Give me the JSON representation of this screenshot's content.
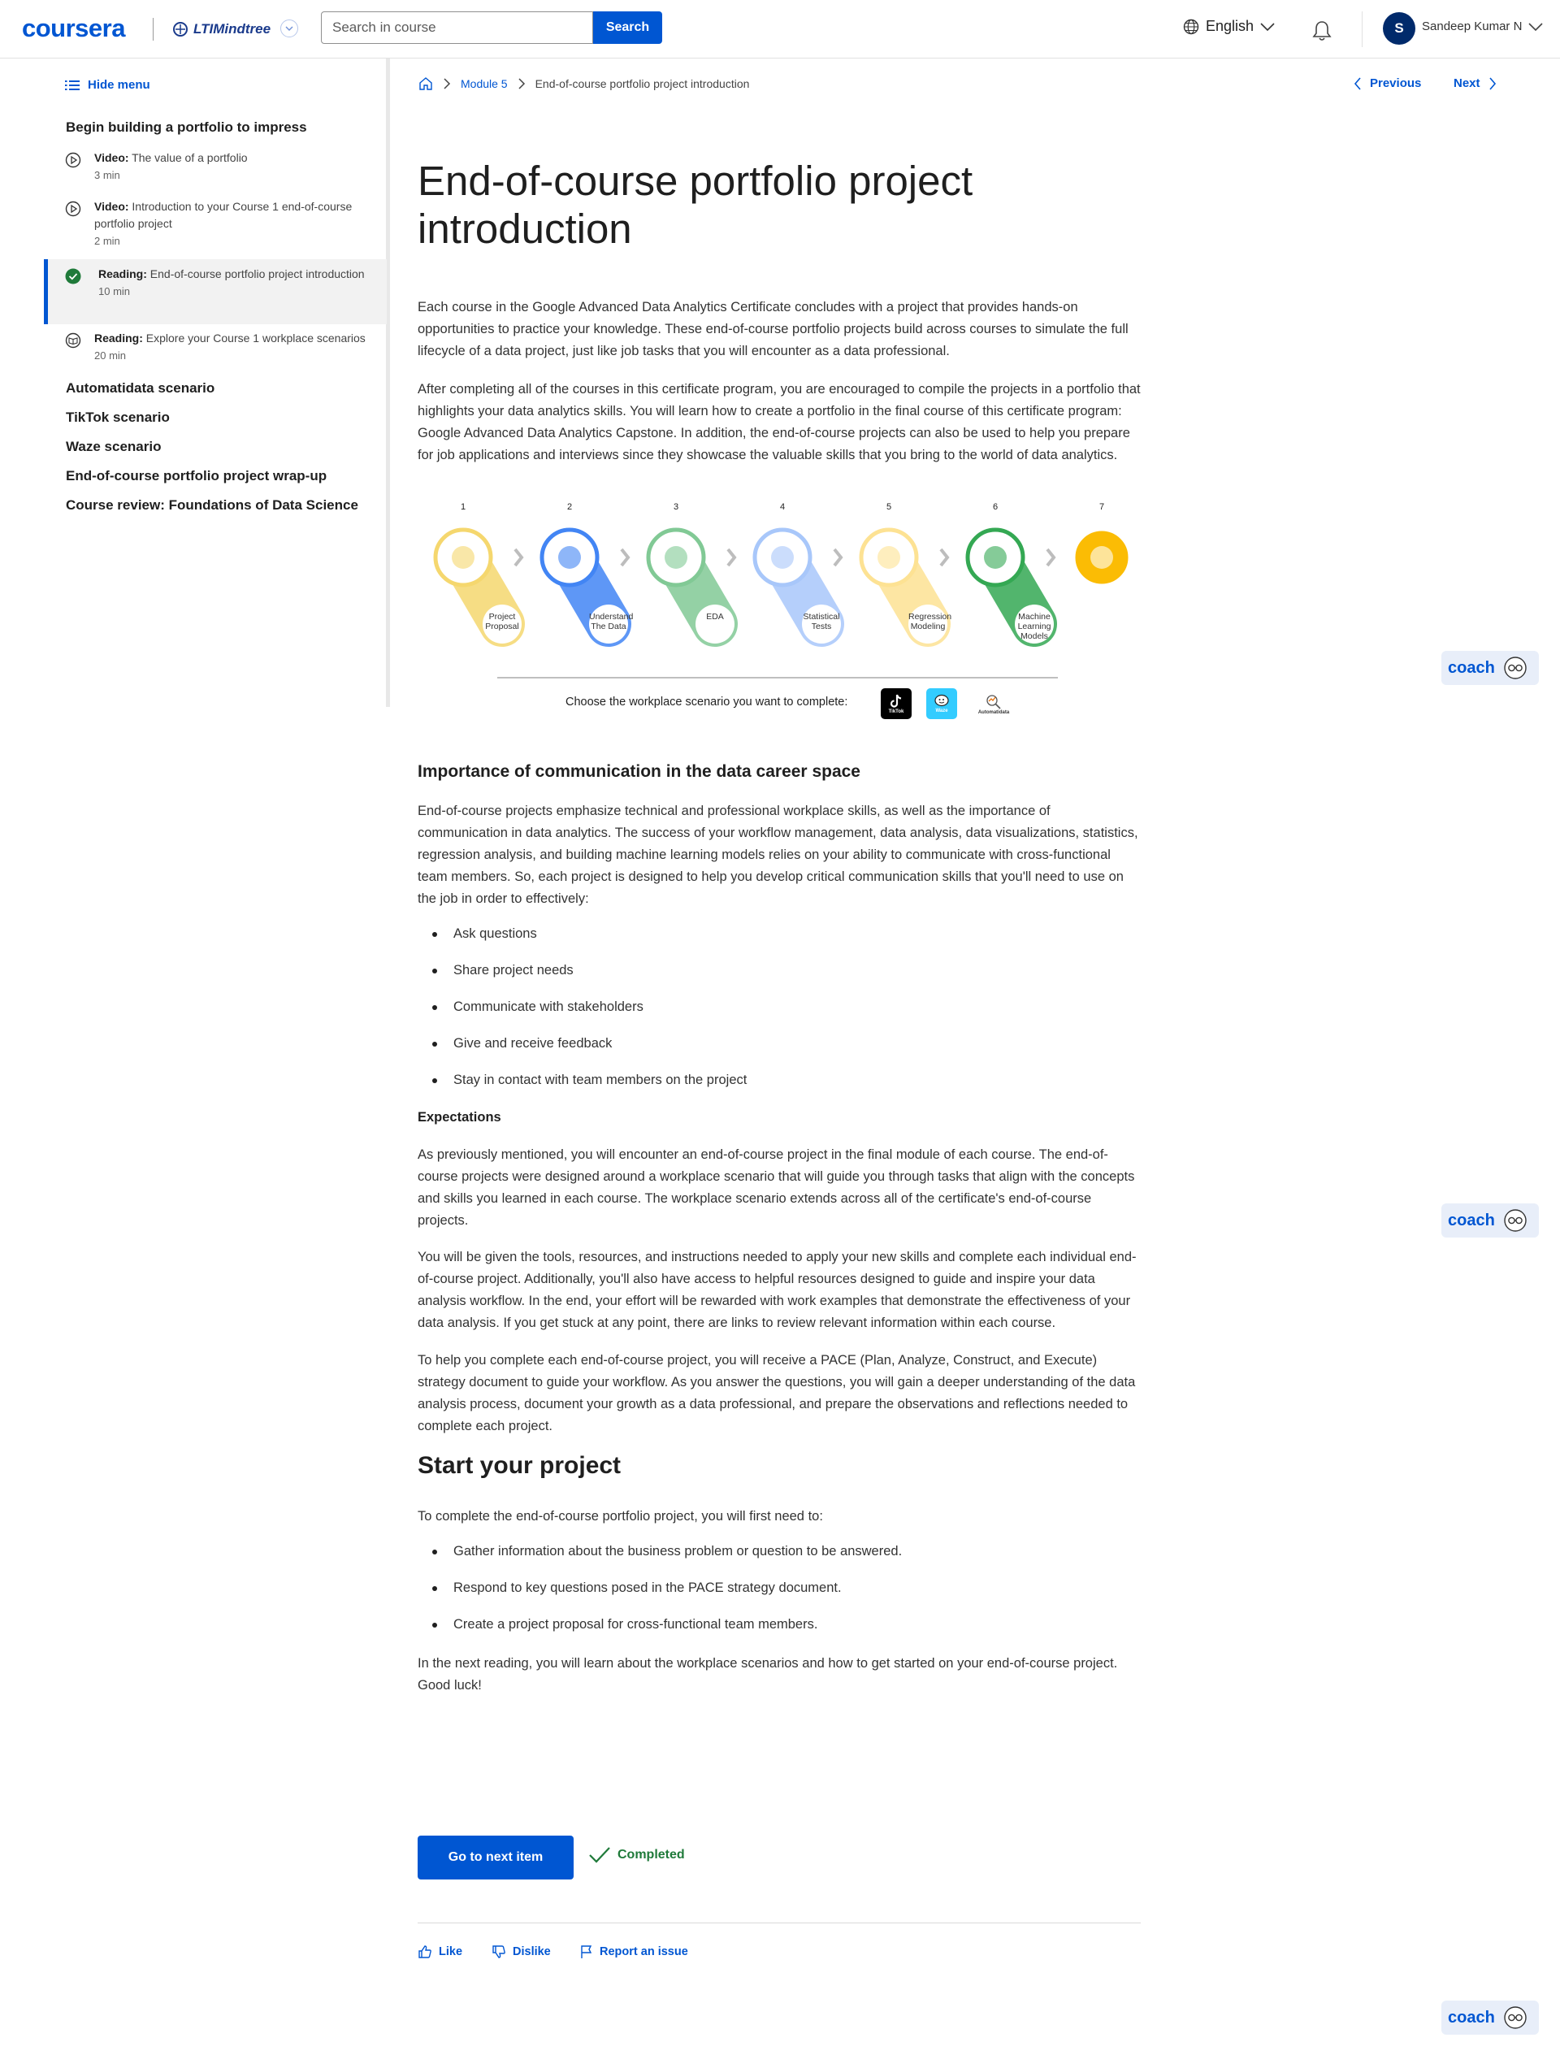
{
  "header": {
    "logo": "coursera",
    "partner": "LTIMindtree",
    "search_placeholder": "Search in course",
    "search_button": "Search",
    "language": "English",
    "avatar_initial": "S",
    "user_name": "Sandeep Kumar N"
  },
  "sidebar": {
    "hide_menu": "Hide menu",
    "section_title": "Begin building a portfolio to impress",
    "items": [
      {
        "type": "Video:",
        "title": "The value of a portfolio",
        "duration": "3 min"
      },
      {
        "type": "Video:",
        "title": "Introduction to your Course 1 end-of-course portfolio project",
        "duration": "2 min"
      },
      {
        "type": "Reading:",
        "title": "End-of-course portfolio project introduction",
        "duration": "10 min"
      },
      {
        "type": "Reading:",
        "title": "Explore your Course 1 workplace scenarios",
        "duration": "20 min"
      }
    ],
    "sections": [
      "Automatidata scenario",
      "TikTok scenario",
      "Waze scenario",
      "End-of-course portfolio project wrap-up",
      "Course review: Foundations of Data Science"
    ]
  },
  "breadcrumb": {
    "module": "Module 5",
    "current": "End-of-course portfolio project introduction"
  },
  "nav": {
    "previous": "Previous",
    "next": "Next"
  },
  "content": {
    "title": "End-of-course portfolio project introduction",
    "p1": "Each course in the Google Advanced Data Analytics Certificate concludes with a project that provides hands-on opportunities to practice your knowledge. These end-of-course portfolio projects build across courses to simulate the full lifecycle of a data project, just like job tasks that you will encounter as a data professional.",
    "p2": "After completing all of the courses in this certificate program, you are encouraged to compile the projects in a portfolio that highlights your data analytics skills. You will learn how to create a portfolio in the final course of this certificate program: Google Advanced Data Analytics Capstone. In addition, the end-of-course projects can also be used to help you prepare for job applications and interviews since they showcase the valuable skills that you bring to the world of data analytics.",
    "diagram": {
      "steps": [
        {
          "num": "1",
          "label": "Project Proposal",
          "color": "#f5d76e"
        },
        {
          "num": "2",
          "label": "Understand The Data",
          "color": "#4285f4"
        },
        {
          "num": "3",
          "label": "EDA",
          "color": "#81c995"
        },
        {
          "num": "4",
          "label": "Statistical Tests",
          "color": "#a8c7fa"
        },
        {
          "num": "5",
          "label": "Regression Modeling",
          "color": "#fde293"
        },
        {
          "num": "6",
          "label": "Machine Learning Models",
          "color": "#34a853"
        },
        {
          "num": "7",
          "label": "",
          "color": "#fbbc04"
        }
      ],
      "choose_text": "Choose the workplace scenario you want to complete:",
      "apps": [
        "TikTok",
        "Waze",
        "Automatidata"
      ]
    },
    "h_importance": "Importance of communication in the data career space",
    "p3": "End-of-course projects emphasize technical and professional workplace skills, as well as the importance of communication in data analytics. The success of your workflow management, data analysis, data visualizations, statistics, regression analysis, and building machine learning models relies on your ability to communicate with cross-functional team members. So, each project is designed to help you develop critical communication skills that you'll need to use on the job in order to effectively:",
    "list1": [
      "Ask questions",
      "Share project needs",
      "Communicate with stakeholders",
      "Give and receive feedback",
      "Stay in contact with team members on the project"
    ],
    "h_expectations": "Expectations",
    "p4": "As previously mentioned, you will encounter an end-of-course project in the final module of each course. The end-of-course projects were designed around a workplace scenario that will guide you through tasks that align with the concepts and skills you learned in each course. The workplace scenario extends across all of the certificate's end-of-course projects.",
    "p5": "You will be given the tools, resources, and instructions needed to apply your new skills and complete each individual end-of-course project. Additionally, you'll also have access to helpful resources designed to guide and inspire your data analysis workflow. In the end, your effort will be rewarded with work examples that demonstrate the effectiveness of your data analysis. If you get stuck at any point, there are links to review relevant information within each course.",
    "p6": "To help you complete each end-of-course project, you will receive a PACE (Plan, Analyze, Construct, and Execute) strategy document to guide your workflow. As you answer the questions, you will gain a deeper understanding of the data analysis process, document your growth as a data professional, and prepare the observations and reflections needed to complete each project.",
    "h_start": "Start your project",
    "p7": "To complete the end-of-course portfolio project, you will first need to:",
    "list2": [
      "Gather information about the business problem or question to be answered.",
      "Respond to key questions posed in the PACE strategy document.",
      "Create a project proposal for cross-functional team members."
    ],
    "p8": "In the next reading, you will learn about the workplace scenarios and how to get started on your end-of-course project. Good luck!"
  },
  "actions": {
    "next_item": "Go to next item",
    "completed": "Completed",
    "like": "Like",
    "dislike": "Dislike",
    "report": "Report an issue"
  },
  "coach_label": "coach",
  "colors": {
    "brand": "#0056d2",
    "success": "#1f7a3a"
  }
}
